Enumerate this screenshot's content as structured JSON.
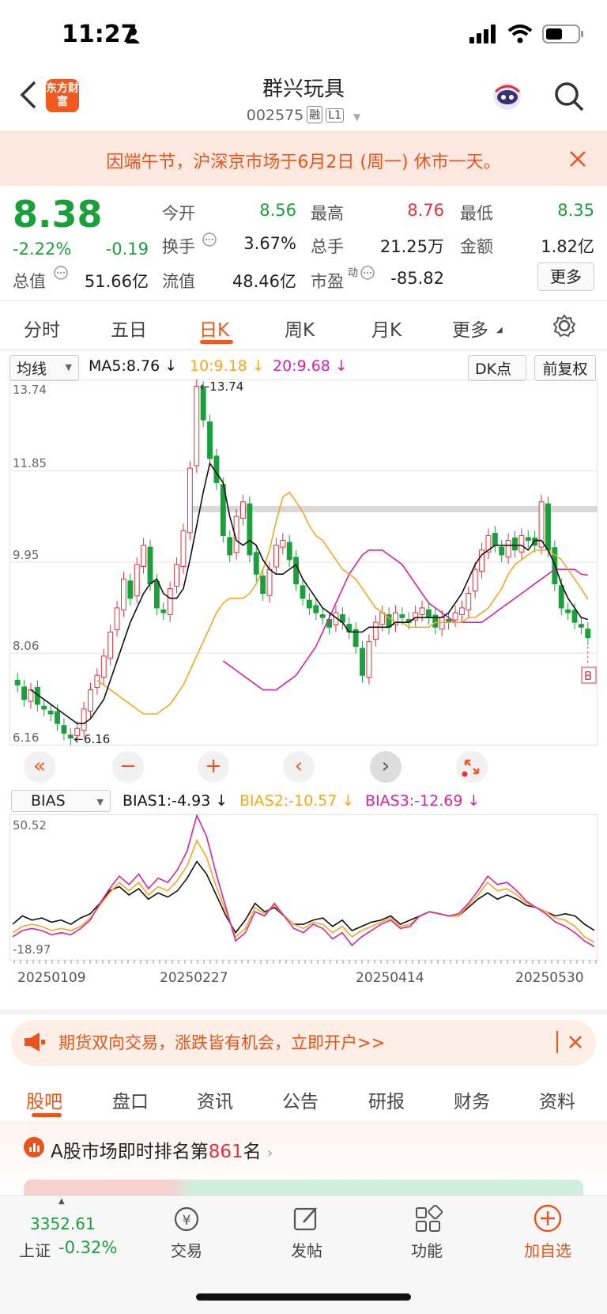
{
  "status": {
    "time": "11:27"
  },
  "header": {
    "logo_text": "东方财富",
    "title": "群兴玩具",
    "code": "002575",
    "tag1": "融",
    "tag2": "L1"
  },
  "notice": {
    "text": "因端午节，沪深京市场于6月2日 (周一) 休市一天。"
  },
  "quote": {
    "price": "8.38",
    "change_pct": "-2.22%",
    "change": "-0.19",
    "total_value_label": "总值",
    "total_value": "51.66亿",
    "open_label": "今开",
    "open": "8.56",
    "high_label": "最高",
    "high": "8.76",
    "low_label": "最低",
    "low": "8.35",
    "turnover_label": "换手",
    "turnover": "3.67%",
    "volume_label": "总手",
    "volume": "21.25万",
    "amount_label": "金额",
    "amount": "1.82亿",
    "float_label": "流值",
    "float_value": "48.46亿",
    "pe_label": "市盈",
    "pe_sup": "动",
    "pe": "-85.82",
    "more_label": "更多"
  },
  "tabs": [
    "分时",
    "五日",
    "日K",
    "周K",
    "月K",
    "更多"
  ],
  "chart_toolbar": {
    "ma_select": "均线",
    "ma5": "MA5:8.76",
    "ma10": "10:9.18",
    "ma20": "20:9.68",
    "dk": "DK点",
    "adjust": "前复权"
  },
  "bias_toolbar": {
    "select": "BIAS",
    "b1": "BIAS1:-4.93",
    "b2": "BIAS2:-10.57",
    "b3": "BIAS3:-12.69"
  },
  "colors": {
    "up": "#e0323b",
    "down": "#1aa03a",
    "accent": "#f05a1e",
    "ma5": "#111111",
    "ma10": "#f5a623",
    "ma20": "#d6249f"
  },
  "chart_data": [
    {
      "type": "candlestick",
      "title": "",
      "y_ticks": [
        "13.74",
        "11.85",
        "9.95",
        "8.06",
        "6.16"
      ],
      "ylim": [
        6.16,
        13.74
      ],
      "annotations": [
        "13.74",
        "6.16",
        "B"
      ],
      "x_ticks": [
        "20250109",
        "20250227",
        "20250414",
        "20250530"
      ],
      "close": [
        7.4,
        7.1,
        7.3,
        7.0,
        6.9,
        6.8,
        6.6,
        6.4,
        6.3,
        6.5,
        6.9,
        7.3,
        7.6,
        8.0,
        8.5,
        9.0,
        9.6,
        9.2,
        9.9,
        10.3,
        9.5,
        9.0,
        8.9,
        9.4,
        9.9,
        10.6,
        11.9,
        13.6,
        12.9,
        12.1,
        11.6,
        10.5,
        10.1,
        10.9,
        11.2,
        10.1,
        9.7,
        9.3,
        9.8,
        10.3,
        10.4,
        10.0,
        9.5,
        9.2,
        9.0,
        8.9,
        8.8,
        8.6,
        8.9,
        8.7,
        8.5,
        8.2,
        7.6,
        8.3,
        8.7,
        8.9,
        8.6,
        8.9,
        8.8,
        8.7,
        8.9,
        9.0,
        8.8,
        8.6,
        8.8,
        8.7,
        8.9,
        9.0,
        9.3,
        9.8,
        10.2,
        10.5,
        10.3,
        10.1,
        10.4,
        10.2,
        10.5,
        10.4,
        10.3,
        11.2,
        10.2,
        9.5,
        9.0,
        8.9,
        8.7,
        8.6,
        8.38
      ],
      "ma5": [
        7.3,
        7.2,
        7.1,
        7.0,
        6.9,
        6.8,
        6.7,
        6.6,
        6.6,
        6.7,
        6.9,
        7.1,
        7.5,
        7.9,
        8.3,
        8.7,
        9.0,
        9.3,
        9.5,
        9.6,
        9.3,
        9.2,
        9.2,
        9.4,
        10.0,
        10.7,
        11.4,
        12.0,
        11.8,
        11.6,
        10.9,
        10.4,
        10.3,
        10.4,
        10.3,
        10.0,
        9.8,
        9.7,
        9.7,
        9.8,
        9.9,
        9.6,
        9.4,
        9.2,
        9.0,
        8.9,
        8.8,
        8.7,
        8.5,
        8.5,
        8.5,
        8.6,
        8.6,
        8.6,
        8.6,
        8.7,
        8.7,
        8.7,
        8.8,
        8.8,
        8.8,
        8.8,
        8.8,
        8.9,
        9.1,
        9.3,
        9.6,
        9.9,
        10.1,
        10.2,
        10.3,
        10.3,
        10.3,
        10.3,
        10.3,
        10.2,
        10.4,
        10.4,
        10.2,
        9.9,
        9.5,
        9.2,
        9.0,
        8.8,
        8.76
      ],
      "ma10": [
        7.5,
        7.4,
        7.3,
        7.2,
        7.1,
        7.0,
        6.9,
        6.8,
        6.8,
        6.8,
        6.9,
        7.0,
        7.2,
        7.4,
        7.7,
        8.0,
        8.3,
        8.6,
        8.9,
        9.1,
        9.2,
        9.2,
        9.2,
        9.3,
        9.5,
        9.8,
        10.2,
        10.8,
        11.3,
        11.4,
        11.2,
        11.0,
        10.7,
        10.5,
        10.4,
        10.2,
        10.0,
        9.8,
        9.7,
        9.6,
        9.4,
        9.2,
        9.0,
        8.9,
        8.8,
        8.7,
        8.7,
        8.6,
        8.6,
        8.6,
        8.6,
        8.7,
        8.7,
        8.7,
        8.7,
        8.7,
        8.8,
        8.8,
        8.9,
        9.0,
        9.2,
        9.4,
        9.7,
        9.9,
        10.0,
        10.1,
        10.2,
        10.2,
        10.2,
        10.1,
        10.0,
        9.8,
        9.6,
        9.4,
        9.18
      ],
      "ma20": [
        7.9,
        7.8,
        7.7,
        7.6,
        7.5,
        7.4,
        7.3,
        7.3,
        7.3,
        7.4,
        7.5,
        7.6,
        7.8,
        8.0,
        8.2,
        8.5,
        8.8,
        9.1,
        9.4,
        9.7,
        9.9,
        10.1,
        10.2,
        10.2,
        10.2,
        10.1,
        10.0,
        9.9,
        9.7,
        9.5,
        9.3,
        9.1,
        9.0,
        8.9,
        8.8,
        8.7,
        8.7,
        8.7,
        8.7,
        8.7,
        8.8,
        8.9,
        9.0,
        9.1,
        9.2,
        9.3,
        9.4,
        9.5,
        9.6,
        9.7,
        9.8,
        9.8,
        9.8,
        9.8,
        9.7,
        9.68
      ]
    },
    {
      "type": "line",
      "title": "",
      "y_ticks": [
        "50.52",
        "-18.97"
      ],
      "ylim": [
        -18.97,
        50.52
      ],
      "series": [
        {
          "name": "BIAS1",
          "values": [
            -2,
            2,
            0,
            1,
            -1,
            0,
            -2,
            1,
            3,
            8,
            14,
            16,
            12,
            15,
            10,
            13,
            11,
            14,
            20,
            28,
            22,
            12,
            2,
            -6,
            0,
            8,
            4,
            6,
            2,
            -2,
            -2,
            0,
            1,
            -3,
            0,
            -5,
            -3,
            -1,
            0,
            2,
            -2,
            0,
            2,
            4,
            3,
            2,
            2,
            6,
            10,
            13,
            10,
            12,
            10,
            7,
            6,
            4,
            2,
            3,
            2,
            -2,
            -4.93
          ]
        },
        {
          "name": "BIAS2",
          "values": [
            -6,
            -3,
            -2,
            -3,
            -5,
            -4,
            -5,
            -3,
            1,
            7,
            13,
            18,
            14,
            18,
            12,
            16,
            14,
            19,
            26,
            38,
            30,
            16,
            4,
            -8,
            -4,
            6,
            3,
            7,
            2,
            -2,
            -4,
            -1,
            -2,
            -6,
            -3,
            -8,
            -5,
            -3,
            -1,
            1,
            -3,
            -2,
            2,
            4,
            3,
            2,
            2,
            7,
            12,
            18,
            14,
            15,
            12,
            8,
            6,
            4,
            1,
            0,
            -3,
            -8,
            -10.57
          ]
        },
        {
          "name": "BIAS3",
          "values": [
            -8,
            -5,
            -4,
            -5,
            -7,
            -6,
            -7,
            -4,
            0,
            8,
            15,
            21,
            17,
            22,
            15,
            20,
            18,
            24,
            33,
            50,
            40,
            22,
            6,
            -10,
            -6,
            4,
            2,
            8,
            2,
            -4,
            -6,
            -2,
            -4,
            -9,
            -6,
            -12,
            -8,
            -5,
            -2,
            0,
            -4,
            -3,
            2,
            4,
            3,
            2,
            3,
            8,
            14,
            21,
            17,
            18,
            14,
            9,
            6,
            3,
            -1,
            -3,
            -6,
            -10,
            -12.69
          ]
        }
      ]
    }
  ],
  "tools": [
    "«",
    "−",
    "+",
    "‹",
    "›",
    "expand"
  ],
  "promo": {
    "text": "期货双向交易，涨跌皆有机会，立即开户>>"
  },
  "bottom_tabs": [
    "股吧",
    "盘口",
    "资讯",
    "公告",
    "研报",
    "财务",
    "资料"
  ],
  "rank": {
    "prefix": "A股市场即时排名第",
    "rank": "861",
    "suffix": "名"
  },
  "tabbar": {
    "index_value": "3352.61",
    "index_name": "上证",
    "index_change": "-0.32%",
    "items": [
      "交易",
      "发帖",
      "功能",
      "加自选"
    ]
  }
}
